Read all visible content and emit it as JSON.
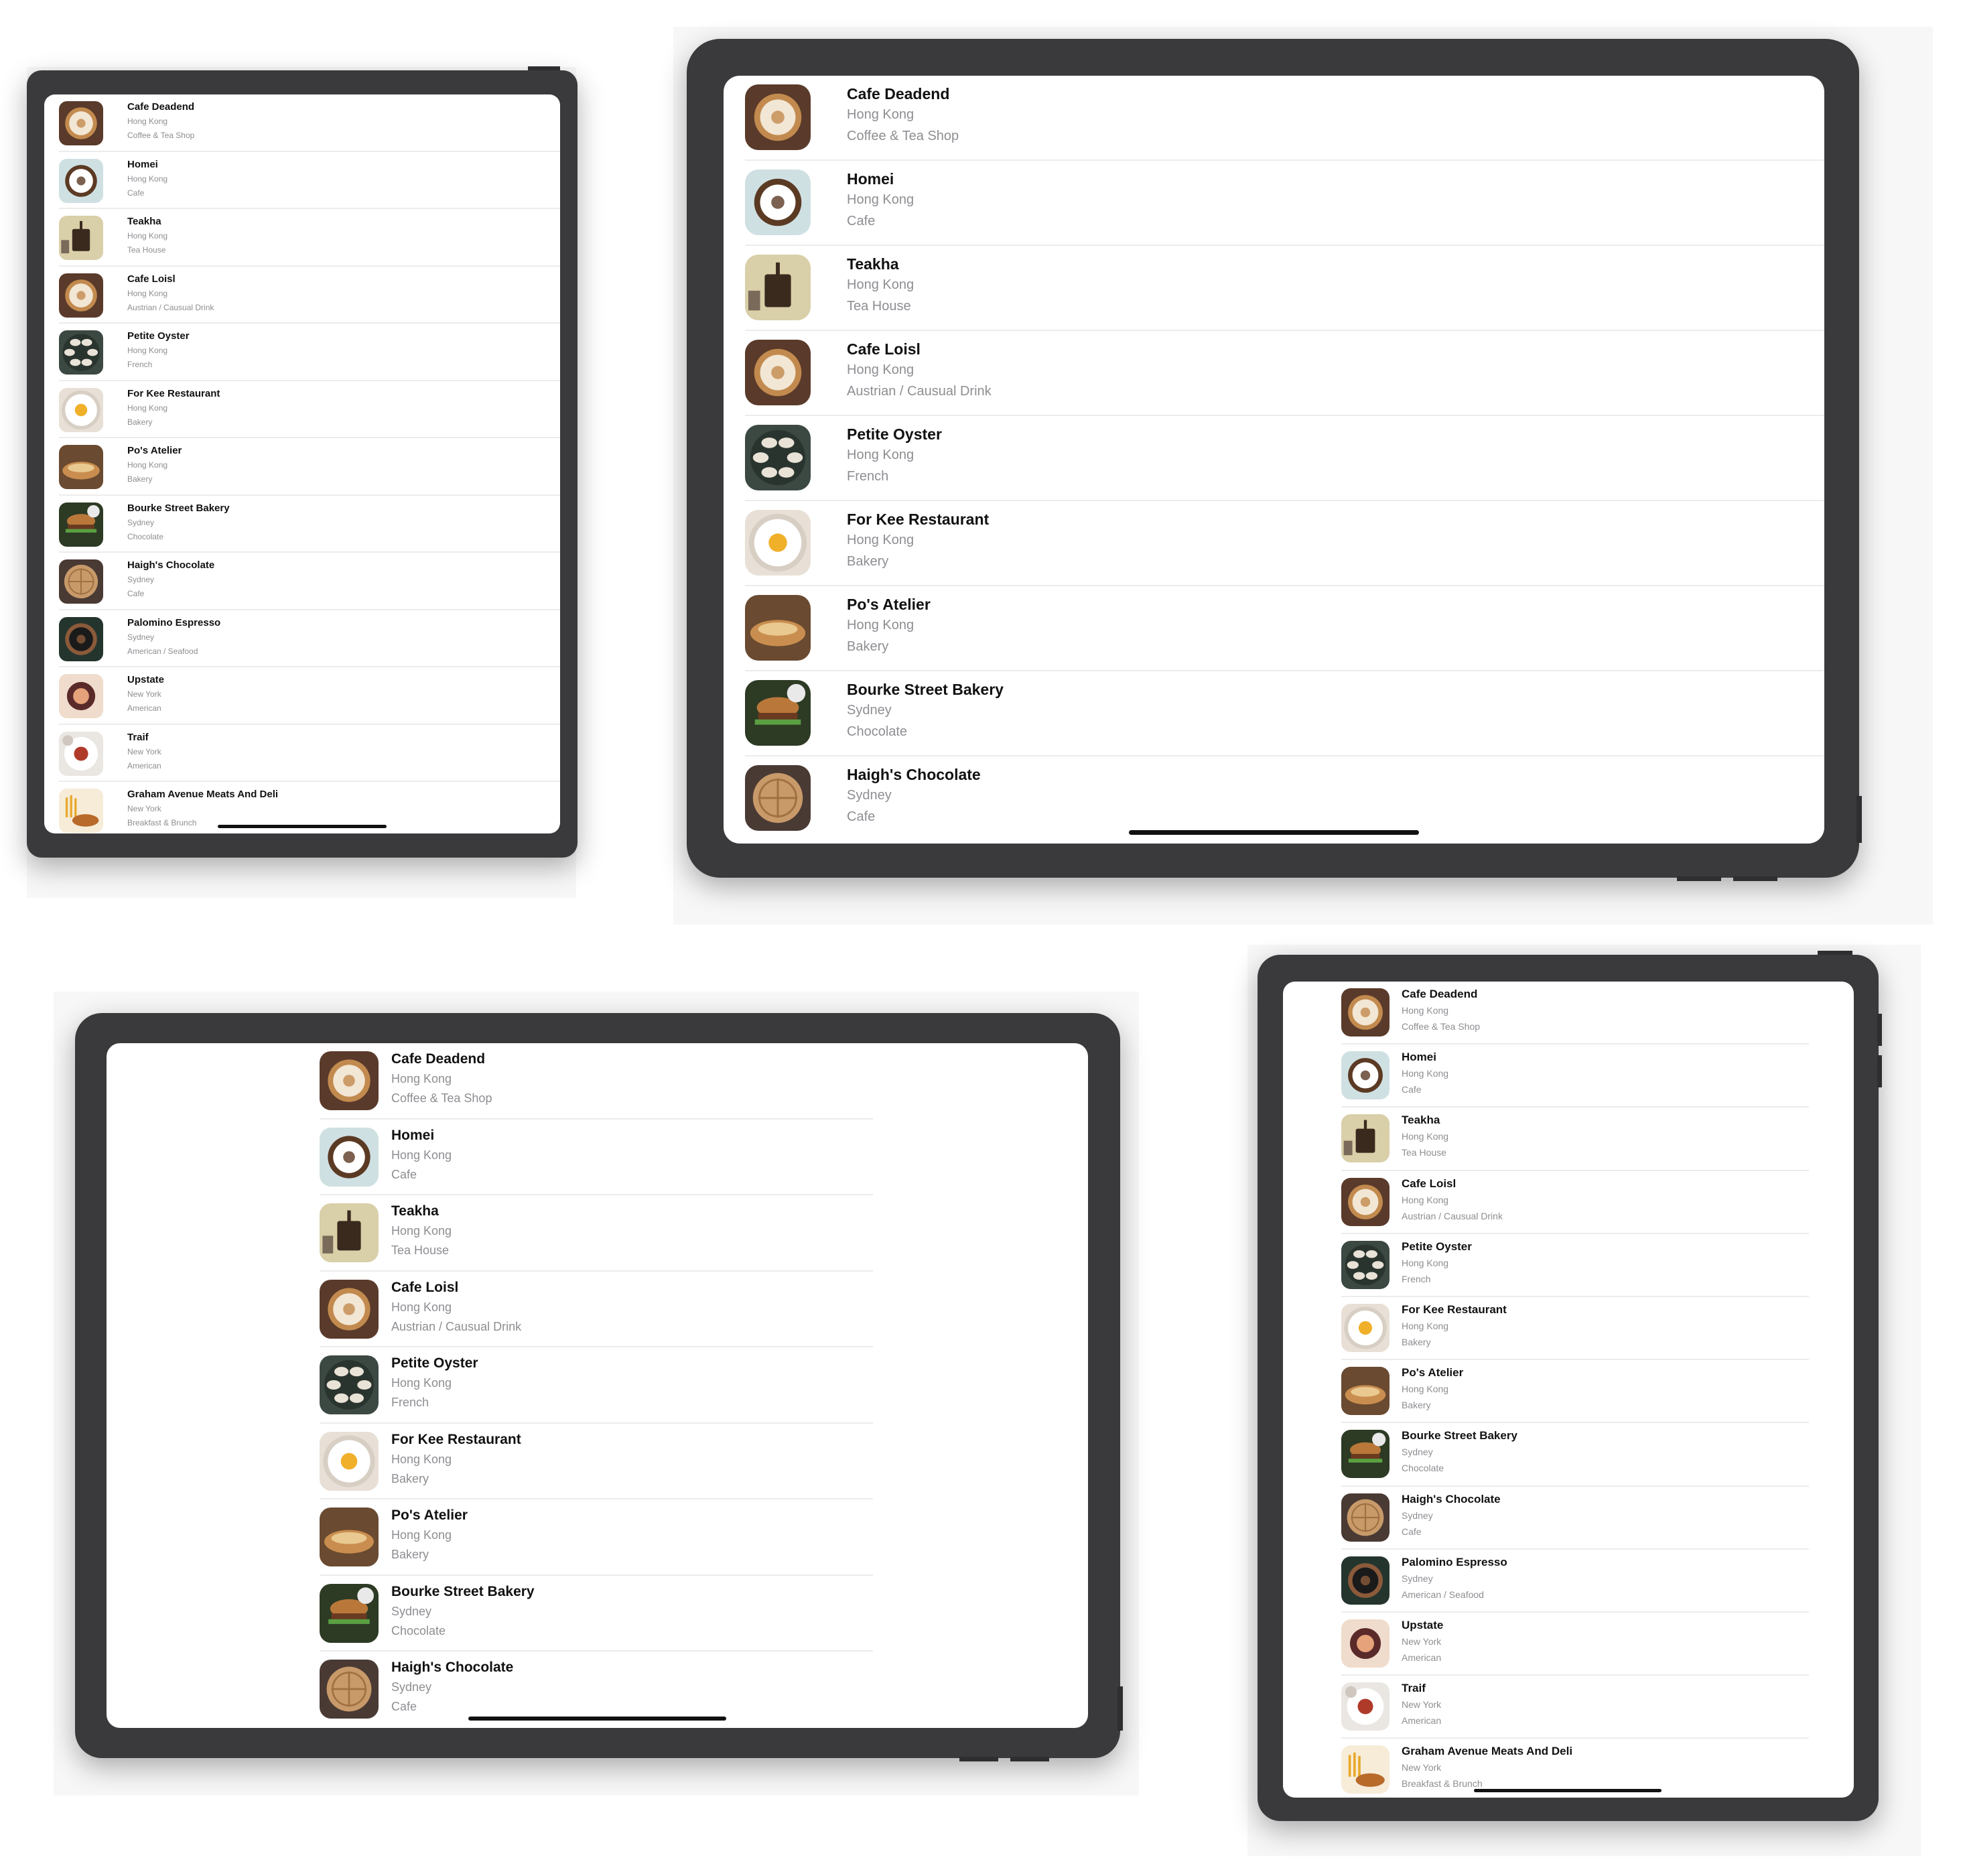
{
  "restaurants": [
    {
      "name": "Cafe Deadend",
      "location": "Hong Kong",
      "type": "Coffee & Tea Shop",
      "icon": "latte-art-cup"
    },
    {
      "name": "Homei",
      "location": "Hong Kong",
      "type": "Cafe",
      "icon": "coffee-cup-topdown"
    },
    {
      "name": "Teakha",
      "location": "Hong Kong",
      "type": "Tea House",
      "icon": "tea-press"
    },
    {
      "name": "Cafe Loisl",
      "location": "Hong Kong",
      "type": "Austrian / Causual Drink",
      "icon": "latte-art-cup"
    },
    {
      "name": "Petite Oyster",
      "location": "Hong Kong",
      "type": "French",
      "icon": "oyster-platter"
    },
    {
      "name": "For Kee Restaurant",
      "location": "Hong Kong",
      "type": "Bakery",
      "icon": "fried-egg-plate"
    },
    {
      "name": "Po's Atelier",
      "location": "Hong Kong",
      "type": "Bakery",
      "icon": "bread-loaf"
    },
    {
      "name": "Bourke Street Bakery",
      "location": "Sydney",
      "type": "Chocolate",
      "icon": "burger"
    },
    {
      "name": "Haigh's Chocolate",
      "location": "Sydney",
      "type": "Cafe",
      "icon": "waffle"
    },
    {
      "name": "Palomino Espresso",
      "location": "Sydney",
      "type": "American / Seafood",
      "icon": "espresso-cup"
    },
    {
      "name": "Upstate",
      "location": "New York",
      "type": "American",
      "icon": "dessert-bowl"
    },
    {
      "name": "Traif",
      "location": "New York",
      "type": "American",
      "icon": "plated-dish"
    },
    {
      "name": "Graham Avenue Meats And Deli",
      "location": "New York",
      "type": "Breakfast & Brunch",
      "icon": "fries-sandwich"
    }
  ],
  "colors": {
    "device_frame": "#3a3a3c",
    "screen_background": "#ffffff",
    "title_text": "#111111",
    "subtitle_text": "#8e8e93",
    "separator": "#ececec"
  }
}
